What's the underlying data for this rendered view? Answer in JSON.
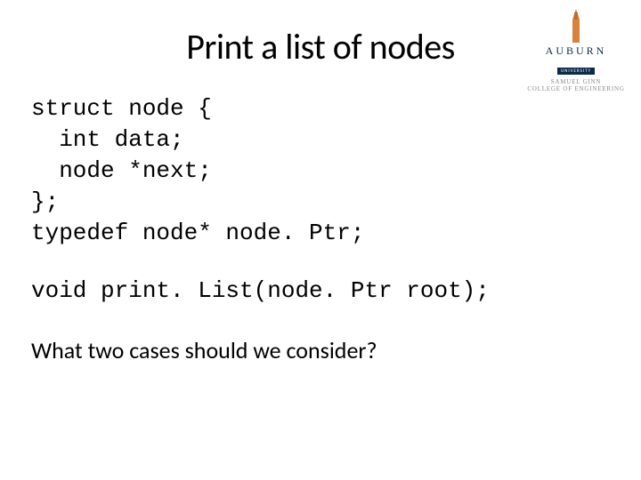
{
  "title": "Print a list of nodes",
  "code1": "struct node {\n  int data;\n  node *next;\n};\ntypedef node* node. Ptr;",
  "code2": "void print. List(node. Ptr root);",
  "question": "What two cases should we consider?",
  "logo": {
    "name": "AUBURN",
    "subname": "UNIVERSITY",
    "college_line1": "SAMUEL GINN",
    "college_line2": "COLLEGE OF ENGINEERING"
  }
}
